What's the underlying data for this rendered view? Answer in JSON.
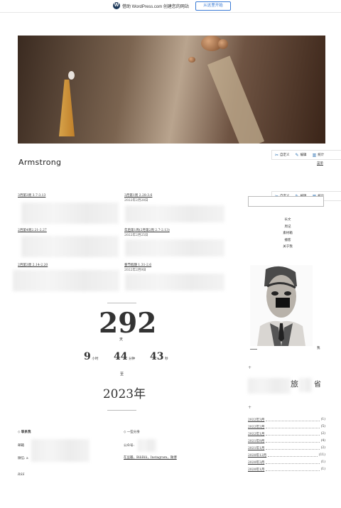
{
  "wpbar": {
    "logo": "W",
    "text": "借助 WordPress.com 创建您的网站",
    "button": "从这里开始"
  },
  "toolbar": {
    "customize": "自定义",
    "edit": "编辑",
    "stats": "统计"
  },
  "site": {
    "title": "Armstrong",
    "menu": "菜单"
  },
  "posts": [
    {
      "title": "3月第3周 3.7-3.13",
      "date": ""
    },
    {
      "title": "3月第1周 2.28-3.6",
      "date": "2022年2月28日"
    },
    {
      "title": "2月第4周2.21-2.27",
      "date": ""
    },
    {
      "title": "年后第1周(2月第2周 2.7-2.13)",
      "date": "2022年2月25日"
    },
    {
      "title": "2月第3周 2.14-2.20",
      "date": ""
    },
    {
      "title": "春节假期 1.31-2.6",
      "date": "2022年2月9日"
    }
  ],
  "countdown": {
    "days": "292",
    "days_unit": "天",
    "hours": "9",
    "hours_unit": "小时",
    "minutes": "44",
    "minutes_unit": "分钟",
    "seconds": "43",
    "seconds_unit": "秒",
    "to": "至",
    "year": "2023年"
  },
  "footer": {
    "contact_heading": "联系我",
    "contact_email_label": "邮箱",
    "contact_wechat_label": "微信: ",
    "wechat_partial": "a",
    "follow_heading": "一些分身",
    "official_label": "公众号: ",
    "links": "在豆瓣，BiliBili，Instagram，微博",
    "rss": "RSS"
  },
  "sidebar": {
    "nav": [
      "长文",
      "周记",
      "素材箱",
      "播客",
      "关于我"
    ],
    "portrait_caption": "我",
    "plus1": "+",
    "plus2": "+",
    "travel_text": "旅",
    "travel_text2": "省",
    "archives": [
      {
        "month": "2022年3月",
        "count": "(1)"
      },
      {
        "month": "2022年2月",
        "count": "(5)"
      },
      {
        "month": "2022年1月",
        "count": "(2)"
      },
      {
        "month": "2021年9月",
        "count": "(4)"
      },
      {
        "month": "2021年1月",
        "count": "(2)"
      },
      {
        "month": "2020年12月",
        "count": "(11)"
      },
      {
        "month": "2020年3月",
        "count": "(1)"
      },
      {
        "month": "2020年1月",
        "count": "(1)"
      }
    ]
  }
}
